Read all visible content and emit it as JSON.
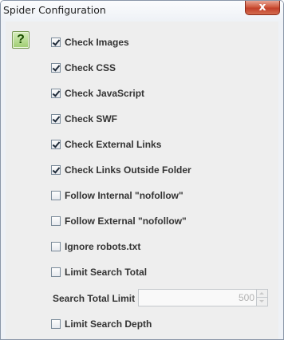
{
  "window": {
    "title": "Spider Configuration",
    "close_glyph": "x"
  },
  "help": {
    "icon": "help-icon",
    "glyph": "?"
  },
  "options": [
    {
      "label": "Check Images",
      "checked": true
    },
    {
      "label": "Check CSS",
      "checked": true
    },
    {
      "label": "Check JavaScript",
      "checked": true
    },
    {
      "label": "Check SWF",
      "checked": true
    },
    {
      "label": "Check External Links",
      "checked": true
    },
    {
      "label": "Check Links Outside Folder",
      "checked": true
    },
    {
      "label": "Follow Internal \"nofollow\"",
      "checked": false
    },
    {
      "label": "Follow External \"nofollow\"",
      "checked": false
    },
    {
      "label": "Ignore robots.txt",
      "checked": false
    },
    {
      "label": "Limit Search Total",
      "checked": false
    }
  ],
  "search_total_limit": {
    "label": "Search Total Limit",
    "value": "500",
    "enabled": false
  },
  "limit_search_depth": {
    "label": "Limit Search Depth",
    "checked": false
  },
  "colors": {
    "help_icon_fill": "#9fcd72",
    "close_button": "#c2402a",
    "panel_background": "#eeeeee"
  }
}
